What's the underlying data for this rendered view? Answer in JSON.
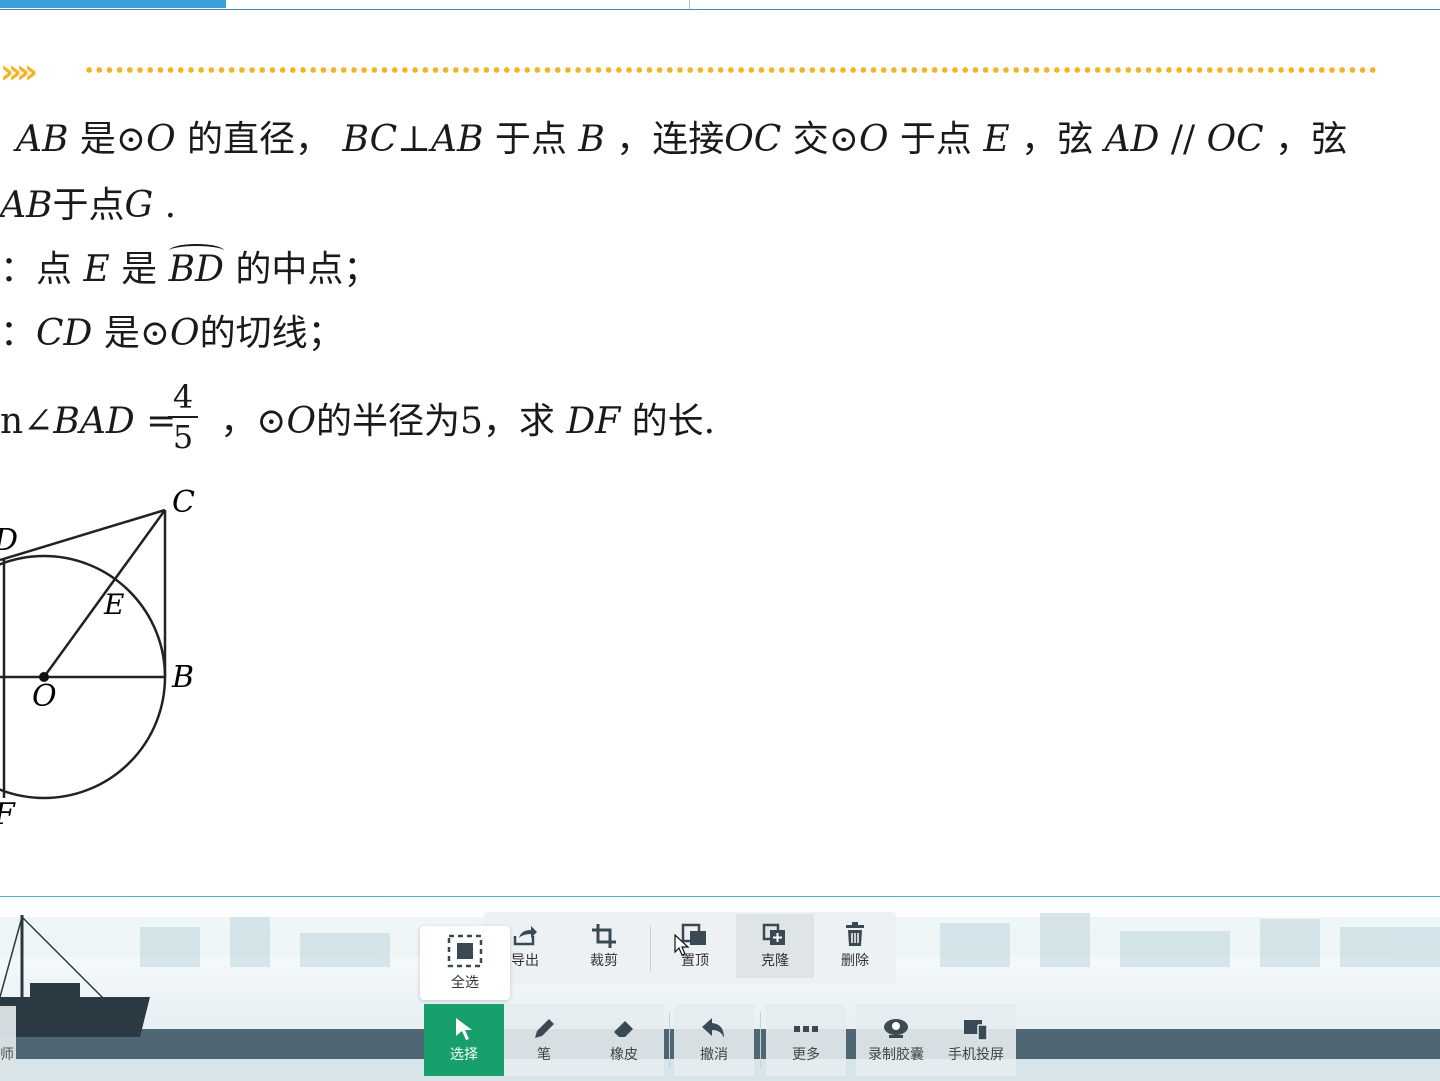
{
  "problem": {
    "line1": {
      "p1": "AB",
      "t1": " 是⊙",
      "p2": "O",
      "t2": " 的直径，",
      "p3": "BC",
      "t3": "⊥",
      "p4": "AB",
      "t4": " 于点 ",
      "p5": "B",
      "t5": " ，连接",
      "p6": "OC",
      "t6": " 交⊙",
      "p7": "O",
      "t7": " 于点 ",
      "p8": "E",
      "t8": " ，弦 ",
      "p9": "AD",
      "t9": " // ",
      "p10": "OC",
      "t10": " ，弦"
    },
    "line2": {
      "p1": "AB",
      "t1": "于点",
      "p2": "G",
      "t2": " ."
    },
    "line3": {
      "t1": "：点 ",
      "p1": "E",
      "t2": " 是 ",
      "p2": "BD",
      "t3": " 的中点；"
    },
    "line4": {
      "t1": "：",
      "p1": "CD",
      "t2": " 是⊙",
      "p2": "O",
      "t3": "的切线；"
    },
    "line5": {
      "t1": "n∠",
      "p1": "BAD",
      "t2": " =",
      "num": "4",
      "den": "5",
      "t3": "，⊙",
      "p2": "O",
      "t4": "的半径为5，求 ",
      "p3": "DF",
      "t5": " 的长."
    }
  },
  "figure_labels": {
    "C": "C",
    "D": "D",
    "E": "E",
    "B": "B",
    "O": "O",
    "F": "F"
  },
  "edit_toolbar": {
    "select_all": "全选",
    "export": "导出",
    "crop": "裁剪",
    "bring_top": "置顶",
    "clone": "克隆",
    "delete": "删除"
  },
  "main_toolbar": {
    "select": "选择",
    "pen": "笔",
    "eraser": "橡皮",
    "undo": "撤消",
    "more": "更多",
    "record": "录制胶囊",
    "cast": "手机投屏"
  },
  "left_tab": "师",
  "colors": {
    "accent_green": "#17a06b",
    "dots": "#f5b324",
    "border_blue": "#3a9fd8"
  }
}
